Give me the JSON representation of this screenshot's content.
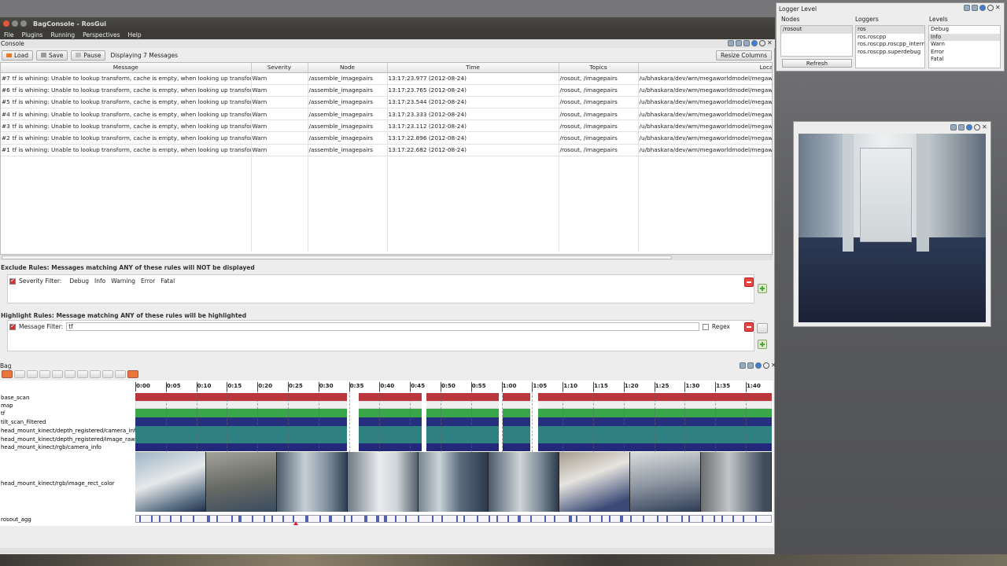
{
  "window": {
    "title": "BagConsole - RosGui"
  },
  "menu": [
    "File",
    "Plugins",
    "Running",
    "Perspectives",
    "Help"
  ],
  "console": {
    "dock_title": "Console",
    "toolbar": {
      "load": "Load",
      "save": "Save",
      "pause": "Pause",
      "status": "Displaying 7 Messages",
      "resize": "Resize Columns"
    },
    "columns": [
      "Message",
      "Severity",
      "Node",
      "Time",
      "Topics",
      "Location"
    ],
    "rows": [
      {
        "id": "#7",
        "message": "tf is whining: Unable to lookup transform, cache is empty, when looking up transform fr...",
        "severity": "Warn",
        "node": "/assemble_imagepairs",
        "time": "13:17:23.977 (2012-08-24)",
        "topics": "/rosout, /imagepairs",
        "location": "/u/bhaskara/dev/wm/megaworldmodel/megaworl"
      },
      {
        "id": "#6",
        "message": "tf is whining: Unable to lookup transform, cache is empty, when looking up transform fr...",
        "severity": "Warn",
        "node": "/assemble_imagepairs",
        "time": "13:17:23.765 (2012-08-24)",
        "topics": "/rosout, /imagepairs",
        "location": "/u/bhaskara/dev/wm/megaworldmodel/megaworl"
      },
      {
        "id": "#5",
        "message": "tf is whining: Unable to lookup transform, cache is empty, when looking up transform fr...",
        "severity": "Warn",
        "node": "/assemble_imagepairs",
        "time": "13:17:23.544 (2012-08-24)",
        "topics": "/rosout, /imagepairs",
        "location": "/u/bhaskara/dev/wm/megaworldmodel/megaworl"
      },
      {
        "id": "#4",
        "message": "tf is whining: Unable to lookup transform, cache is empty, when looking up transform fr...",
        "severity": "Warn",
        "node": "/assemble_imagepairs",
        "time": "13:17:23.333 (2012-08-24)",
        "topics": "/rosout, /imagepairs",
        "location": "/u/bhaskara/dev/wm/megaworldmodel/megaworl"
      },
      {
        "id": "#3",
        "message": "tf is whining: Unable to lookup transform, cache is empty, when looking up transform fr...",
        "severity": "Warn",
        "node": "/assemble_imagepairs",
        "time": "13:17:23.112 (2012-08-24)",
        "topics": "/rosout, /imagepairs",
        "location": "/u/bhaskara/dev/wm/megaworldmodel/megaworl"
      },
      {
        "id": "#2",
        "message": "tf is whining: Unable to lookup transform, cache is empty, when looking up transform fr...",
        "severity": "Warn",
        "node": "/assemble_imagepairs",
        "time": "13:17:22.896 (2012-08-24)",
        "topics": "/rosout, /imagepairs",
        "location": "/u/bhaskara/dev/wm/megaworldmodel/megaworl"
      },
      {
        "id": "#1",
        "message": "tf is whining: Unable to lookup transform, cache is empty, when looking up transform fr...",
        "severity": "Warn",
        "node": "/assemble_imagepairs",
        "time": "13:17:22.682 (2012-08-24)",
        "topics": "/rosout, /imagepairs",
        "location": "/u/bhaskara/dev/wm/megaworldmodel/megaworl"
      }
    ]
  },
  "exclude": {
    "title": "Exclude Rules: Messages matching ANY of these rules will NOT be displayed",
    "filter_label": "Severity Filter:",
    "severities": [
      "Debug",
      "Info",
      "Warning",
      "Error",
      "Fatal"
    ]
  },
  "highlight": {
    "title": "Highlight Rules: Message matching ANY of these rules will be highlighted",
    "filter_label": "Message Filter:",
    "filter_value": "tf",
    "regex_label": "Regex"
  },
  "bag": {
    "dock_title": "Bag",
    "ticks": [
      "0:00",
      "0:05",
      "0:10",
      "0:15",
      "0:20",
      "0:25",
      "0:30",
      "0:35",
      "0:40",
      "0:45",
      "0:50",
      "0:55",
      "1:00",
      "1:05",
      "1:10",
      "1:15",
      "1:20",
      "1:25",
      "1:30",
      "1:35",
      "1:40"
    ],
    "topics": [
      "base_scan",
      "map",
      "tf",
      "tilt_scan_filtered",
      "head_mount_kinect/depth_registered/camera_info",
      "head_mount_kinect/depth_registered/image_raw",
      "head_mount_kinect/rgb/camera_info",
      "head_mount_kinect/rgb/image_rect_color",
      "rosout_agg"
    ],
    "colors": {
      "base_scan": "#b8363c",
      "map": "#efefef",
      "tf": "#3aa64a",
      "tilt": "#27307f",
      "depth_info": "#2f8080",
      "depth_raw": "#2f8080",
      "rgb_info": "#23287a"
    }
  },
  "logger": {
    "title": "Logger Level",
    "nodes_header": "Nodes",
    "loggers_header": "Loggers",
    "levels_header": "Levels",
    "nodes": [
      "/rosout"
    ],
    "loggers": [
      "ros",
      "ros.roscpp",
      "ros.roscpp.roscpp_internal",
      "ros.roscpp.superdebug"
    ],
    "levels": [
      "Debug",
      "Info",
      "Warn",
      "Error",
      "Fatal"
    ],
    "refresh": "Refresh"
  }
}
